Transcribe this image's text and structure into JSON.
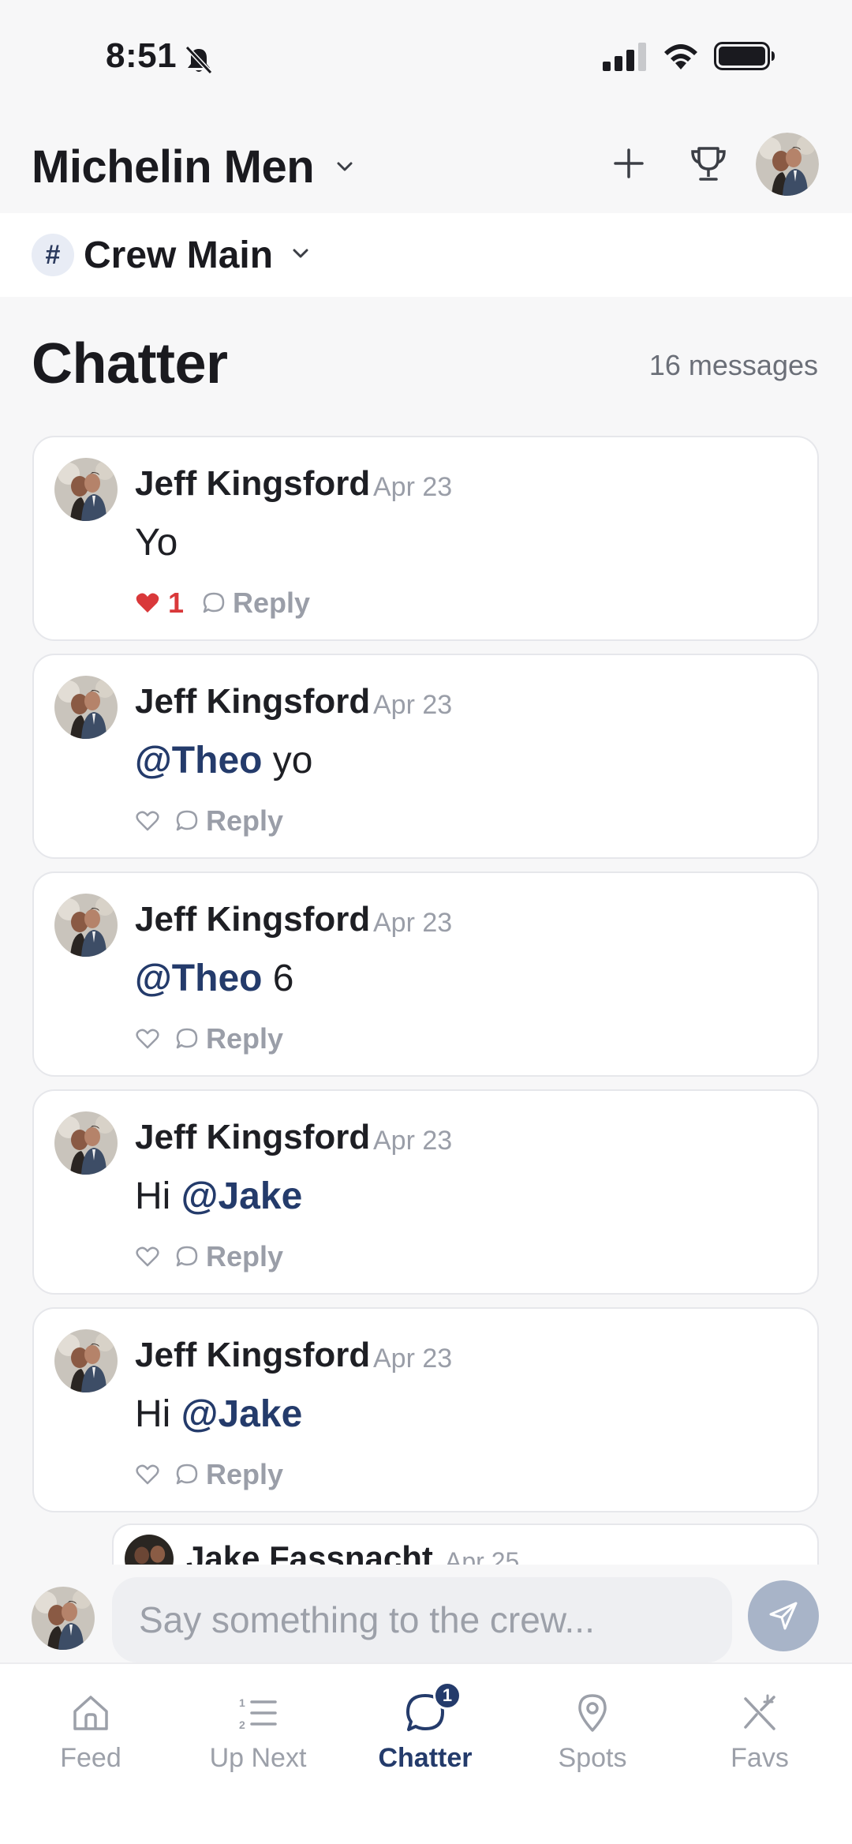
{
  "status_bar": {
    "time": "8:51"
  },
  "header": {
    "crew_name": "Michelin Men"
  },
  "channel": {
    "hash": "#",
    "name": "Crew Main"
  },
  "chatter": {
    "title": "Chatter",
    "message_count": "16 messages"
  },
  "messages": [
    {
      "author": "Jeff Kingsford",
      "date": "Apr 23",
      "text_before": "",
      "mention": "",
      "text_after": "Yo",
      "liked": true,
      "like_count": "1",
      "reply_label": "Reply"
    },
    {
      "author": "Jeff Kingsford",
      "date": "Apr 23",
      "text_before": "",
      "mention": "@Theo",
      "text_after": " yo",
      "liked": false,
      "like_count": "",
      "reply_label": "Reply"
    },
    {
      "author": "Jeff Kingsford",
      "date": "Apr 23",
      "text_before": "",
      "mention": "@Theo",
      "text_after": " 6",
      "liked": false,
      "like_count": "",
      "reply_label": "Reply"
    },
    {
      "author": "Jeff Kingsford",
      "date": "Apr 23",
      "text_before": "Hi ",
      "mention": "@Jake",
      "text_after": "",
      "liked": false,
      "like_count": "",
      "reply_label": "Reply"
    },
    {
      "author": "Jeff Kingsford",
      "date": "Apr 23",
      "text_before": "Hi ",
      "mention": "@Jake",
      "text_after": "",
      "liked": false,
      "like_count": "",
      "reply_label": "Reply"
    }
  ],
  "reply_preview": {
    "author": "Jake Fassnacht",
    "date": "Apr 25"
  },
  "composer": {
    "placeholder": "Say something to the crew..."
  },
  "tabs": [
    {
      "label": "Feed",
      "icon": "home-icon",
      "active": false
    },
    {
      "label": "Up Next",
      "icon": "ordered-list-icon",
      "active": false
    },
    {
      "label": "Chatter",
      "icon": "chat-bubble-icon",
      "active": true,
      "badge": "1"
    },
    {
      "label": "Spots",
      "icon": "map-pin-icon",
      "active": false
    },
    {
      "label": "Favs",
      "icon": "utensils-crossed-icon",
      "active": false
    }
  ],
  "colors": {
    "accent": "#243b6b",
    "like": "#d9383a",
    "muted": "#9a9ea8",
    "send_button": "#a8b4c8"
  }
}
